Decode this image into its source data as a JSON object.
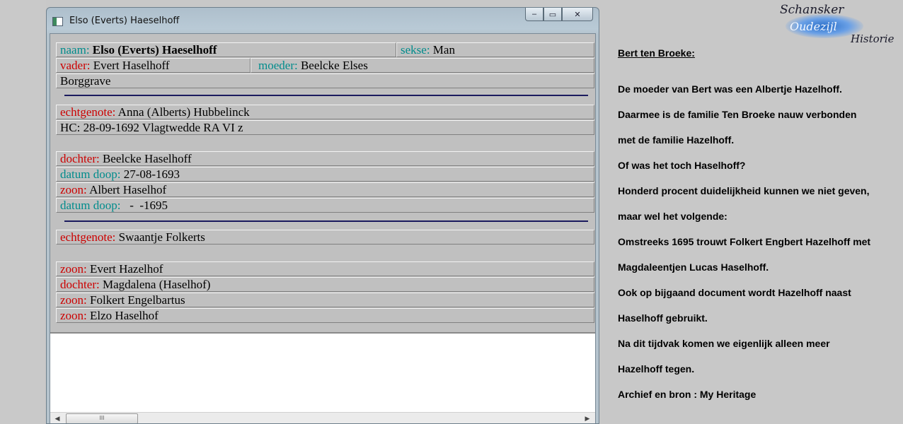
{
  "window": {
    "title": "Elso (Everts) Haeselhoff",
    "buttons": {
      "minimize": "–",
      "maximize": "▭",
      "close": "✕"
    }
  },
  "record": {
    "naam_label": "naam:",
    "naam_value": "Elso (Everts) Haeselhoff",
    "sekse_label": "sekse:",
    "sekse_value": "Man",
    "vader_label": "vader:",
    "vader_value": "Evert Haselhoff",
    "moeder_label": "moeder:",
    "moeder_value": "Beelcke Elses",
    "place": "Borggrave",
    "spouse1_label": "echtgenote:",
    "spouse1_value": "Anna (Alberts) Hubbelinck",
    "marriage1": "HC: 28-09-1692 Vlagtwedde RA VI z",
    "child1_label": "dochter:",
    "child1_value": "Beelcke Haselhoff",
    "child1_doop_label": "datum doop:",
    "child1_doop_value": "27-08-1693",
    "child2_label": "zoon:",
    "child2_value": "Albert Haselhof",
    "child2_doop_label": "datum doop:",
    "child2_doop_value": "  -  -1695",
    "spouse2_label": "echtgenote:",
    "spouse2_value": "Swaantje Folkerts",
    "child3_label": "zoon:",
    "child3_value": "Evert Hazelhof",
    "child4_label": "dochter:",
    "child4_value": "Magdalena (Haselhof)",
    "child5_label": "zoon:",
    "child5_value": "Folkert Engelbartus",
    "child6_label": "zoon:",
    "child6_value": "Elzo Haselhof"
  },
  "scrollbar": {
    "left_arrow": "◀",
    "right_arrow": "▶",
    "thumb_grip": "III"
  },
  "logo": {
    "line1": "Schansker",
    "line2": "Oudezijl",
    "line3": "Historie"
  },
  "article": {
    "heading": "Bert ten Broeke:",
    "lines": [
      "De moeder van Bert was een Albertje Hazelhoff.",
      "Daarmee is de familie Ten Broeke nauw verbonden",
      "met de familie Hazelhoff.",
      "Of was het toch Haselhoff?",
      "Honderd procent duidelijkheid kunnen we niet geven,",
      "maar wel het volgende:",
      "Omstreeks 1695 trouwt Folkert Engbert Hazelhoff met",
      "Magdaleentjen Lucas Haselhoff.",
      "Ook op bijgaand document wordt Hazelhoff naast",
      "Haselhoff gebruikt.",
      "Na dit tijdvak komen we eigenlijk alleen meer",
      "Hazelhoff tegen.",
      "Archief en bron : My Heritage"
    ]
  },
  "colors": {
    "label_red": "#cc0000",
    "label_teal": "#008c8c",
    "separator": "#1a1a5e"
  }
}
